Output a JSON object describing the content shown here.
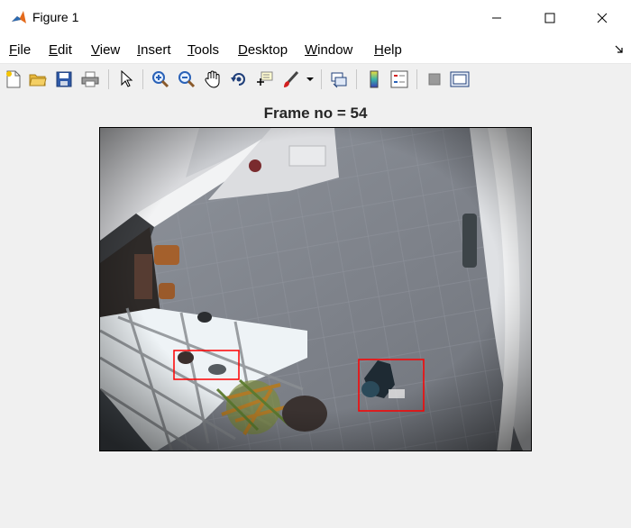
{
  "window": {
    "title": "Figure 1"
  },
  "menu": {
    "items": [
      {
        "u": "F",
        "rest": "ile"
      },
      {
        "u": "E",
        "rest": "dit"
      },
      {
        "u": "V",
        "rest": "iew"
      },
      {
        "u": "I",
        "rest": "nsert"
      },
      {
        "u": "T",
        "rest": "ools"
      },
      {
        "u": "D",
        "rest": "esktop"
      },
      {
        "u": "W",
        "rest": "indow"
      },
      {
        "u": "H",
        "rest": "elp"
      }
    ]
  },
  "toolbar": {
    "icons": [
      "new-figure-icon",
      "open-file-icon",
      "save-icon",
      "print-icon",
      "pointer-icon",
      "zoom-in-icon",
      "zoom-out-icon",
      "pan-hand-icon",
      "rotate-3d-icon",
      "data-cursor-icon",
      "brush-icon",
      "brush-dropdown-icon",
      "link-plot-icon",
      "colorbar-icon",
      "legend-icon",
      "hide-plot-tools-icon",
      "show-plot-tools-icon"
    ]
  },
  "axes": {
    "title": "Frame no = 54"
  },
  "detections": [
    {
      "label": "tracked-person-box-1",
      "color": "#ff0000"
    },
    {
      "label": "tracked-person-box-2",
      "color": "#ff0000"
    }
  ],
  "colors": {
    "accent": "#0078d7",
    "box": "#ff0000",
    "figure_bg": "#f0f0f0"
  }
}
